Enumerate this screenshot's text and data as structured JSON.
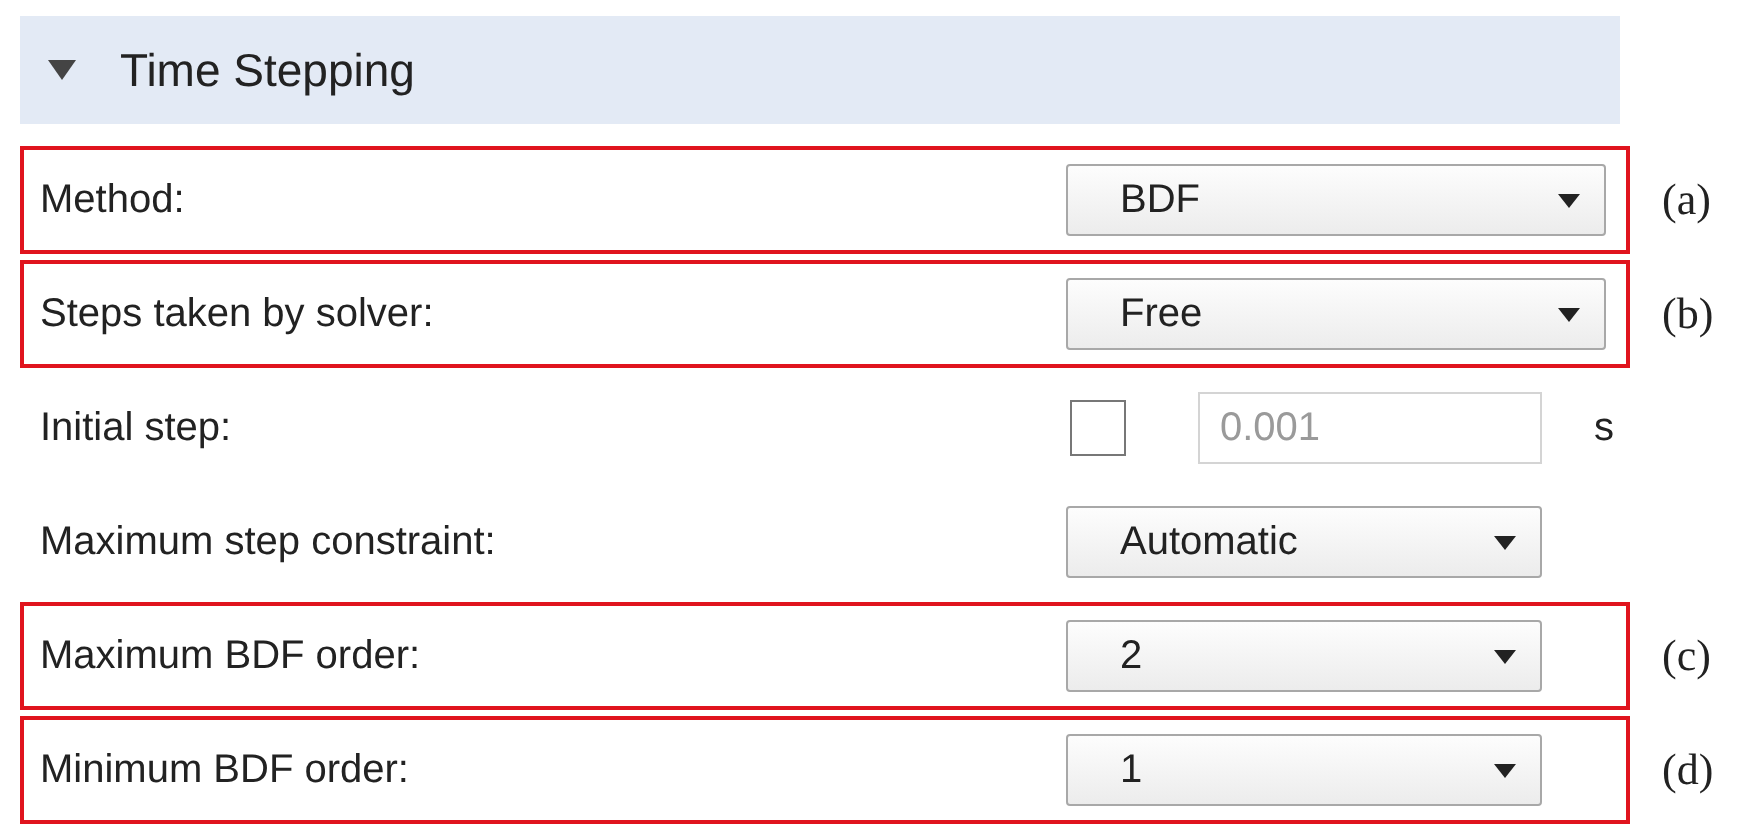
{
  "section": {
    "title": "Time Stepping",
    "expanded": true
  },
  "rows": [
    {
      "kind": "select",
      "label": "Method:",
      "value": "BDF",
      "highlighted": true,
      "annotation": "(a)"
    },
    {
      "kind": "select",
      "label": "Steps taken by solver:",
      "value": "Free",
      "highlighted": true,
      "annotation": "(b)"
    },
    {
      "kind": "checkbox_input",
      "label": "Initial step:",
      "checked": false,
      "value": "0.001",
      "disabled": true,
      "unit": "s",
      "highlighted": false
    },
    {
      "kind": "select",
      "label": "Maximum step constraint:",
      "value": "Automatic",
      "highlighted": false
    },
    {
      "kind": "select",
      "label": "Maximum BDF order:",
      "value": "2",
      "highlighted": true,
      "annotation": "(c)"
    },
    {
      "kind": "select",
      "label": "Minimum BDF order:",
      "value": "1",
      "highlighted": true,
      "annotation": "(d)"
    }
  ]
}
